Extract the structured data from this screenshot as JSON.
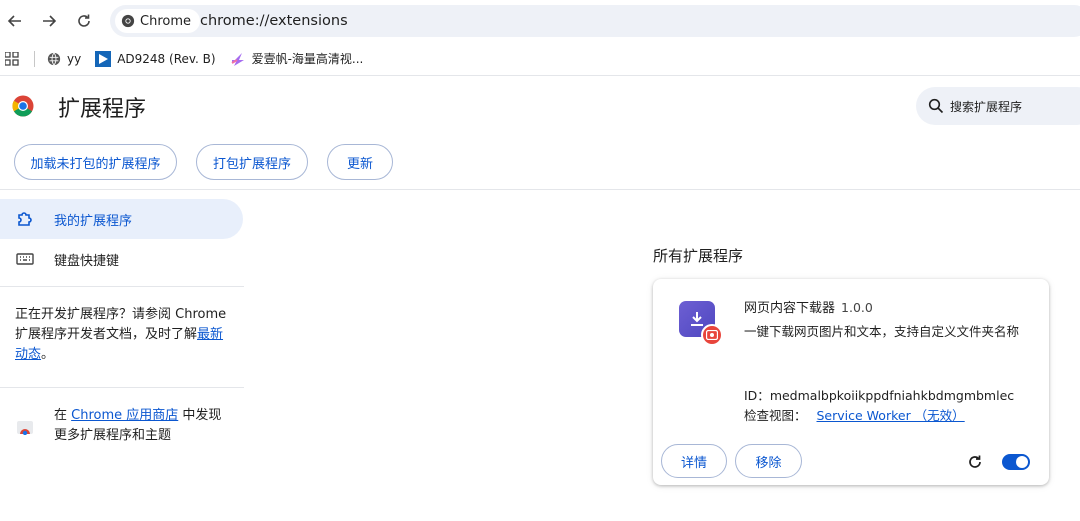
{
  "browser": {
    "chip_label": "Chrome",
    "url": "chrome://extensions"
  },
  "bookmarks": [
    {
      "label": "yy"
    },
    {
      "label": "AD9248 (Rev. B)"
    },
    {
      "label": "爱壹帆-海量高清视..."
    }
  ],
  "header": {
    "title": "扩展程序",
    "search_placeholder": "搜索扩展程序"
  },
  "toolbar": {
    "load_unpacked": "加载未打包的扩展程序",
    "pack": "打包扩展程序",
    "update": "更新"
  },
  "sidebar": {
    "items": [
      {
        "label": "我的扩展程序",
        "active": true
      },
      {
        "label": "键盘快捷键",
        "active": false
      }
    ],
    "dev_text_1": "正在开发扩展程序？请参阅 Chrome 扩展程序开发者文档，及时了解",
    "dev_link": "最新动态",
    "dev_text_2": "。",
    "store_text_1": "在 ",
    "store_link": "Chrome 应用商店",
    "store_text_2": " 中发现更多扩展程序和主题"
  },
  "main": {
    "section_title": "所有扩展程序",
    "extension": {
      "name": "网页内容下载器",
      "version": "1.0.0",
      "description": "一键下载网页图片和文本，支持自定义文件夹名称",
      "id_label": "ID：",
      "id": "medmalbpkoiikppdfniahkbdmgmbmlec",
      "view_label": "检查视图：",
      "view_link": "Service Worker （无效）",
      "details_button": "详情",
      "remove_button": "移除",
      "enabled": true
    }
  },
  "colors": {
    "accent": "#0b57d0",
    "active_bg": "#e8effb"
  }
}
